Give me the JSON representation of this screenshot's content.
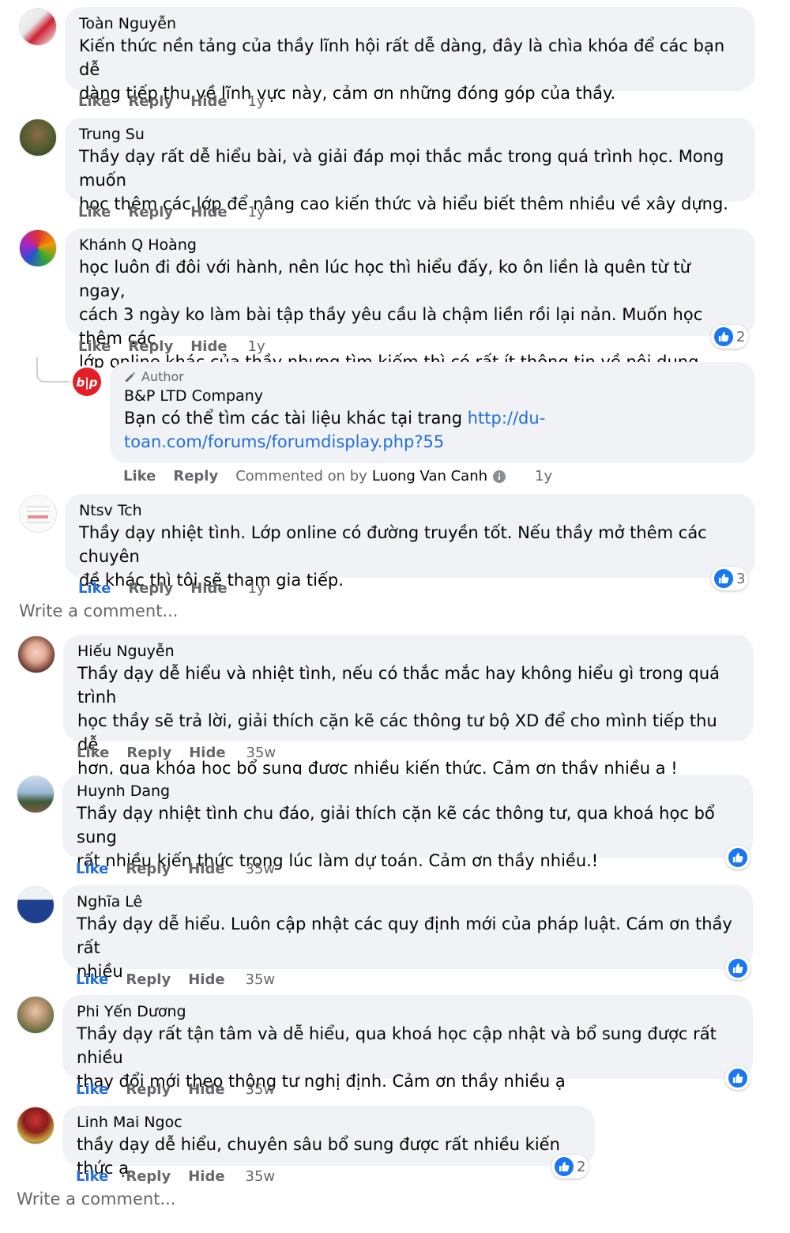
{
  "colors": {
    "bubble": "#f0f2f5",
    "meta": "#65676b",
    "link": "#216fdb",
    "like_blue": "#1877f2"
  },
  "actions": {
    "like": "Like",
    "reply": "Reply",
    "hide": "Hide"
  },
  "comments": [
    {
      "name": "Toàn Nguyễn",
      "lines": [
        "Kiến thức nền tảng của thầy lĩnh hội rất dễ dàng, đây là chìa khóa để các bạn dễ",
        "dàng tiếp thu về lĩnh vực này, cảm ơn những đóng góp của thầy."
      ],
      "time": "1y"
    },
    {
      "name": "Trung Su",
      "lines": [
        "Thầy dạy rất dễ hiểu bài, và giải đáp mọi thắc mắc trong quá trình học. Mong muốn",
        "học thêm các lớp để nâng cao kiến thức và hiểu biết thêm nhiều về xây dựng."
      ],
      "time": "1y"
    },
    {
      "name": "Khánh Q Hoàng",
      "lines": [
        "học luôn đi đôi với hành, nên lúc học thì hiểu đấy, ko ôn liền là quên từ từ ngay,",
        "cách 3 ngày ko làm bài tập thầy yêu cầu là chậm liền rồi lại nản. Muốn học thêm các",
        "lớp online khác của thầy nhưng tìm kiếm thì có rất ít thông tin về nội dung."
      ],
      "time": "1y",
      "reactions": "2"
    },
    {
      "name": "Ntsv Tch",
      "lines": [
        "Thầy dạy nhiệt tình. Lớp online có đường truyền tốt. Nếu thầy mở thêm các chuyên",
        "đề khác thì tôi sẽ tham gia tiếp."
      ],
      "time": "1y",
      "reactions": "3"
    },
    {
      "name": "Hiếu Nguyễn",
      "lines": [
        "Thầy dạy dễ hiểu và nhiệt tình, nếu có thắc mắc hay không hiểu gì trong quá trình",
        "học thầy sẽ trả lời, giải thích cặn kẽ các thông tư bộ XD để cho mình tiếp thu dễ",
        "hơn, qua khóa học bổ sung được nhiều kiến thức. Cảm ơn thầy nhiều ạ !"
      ],
      "time": "35w"
    },
    {
      "name": "Huynh Dang",
      "lines": [
        "Thầy dạy nhiệt tình chu đáo, giải thích cặn kẽ các thông tư, qua khoá học bổ sung",
        "rất nhiều kiến thức trong lúc làm dự toán. Cảm ơn thầy nhiều.!"
      ],
      "time": "35w"
    },
    {
      "name": "Nghĩa Lê",
      "lines": [
        "Thầy dạy dễ hiểu. Luôn cập nhật các quy định mới của pháp luật. Cám ơn thầy rất",
        "nhiều"
      ],
      "time": "35w"
    },
    {
      "name": "Phi Yến Dương",
      "lines": [
        "Thầy dạy rất tận tâm và dễ hiểu, qua khoá học cập nhật và bổ sung được rất nhiều",
        "thay đổi mới theo thông tư nghị định. Cảm ơn thầy nhiều ạ"
      ],
      "time": "35w"
    },
    {
      "name": "Linh Mai Ngoc",
      "lines": [
        "thầy dạy dễ hiểu, chuyên sâu bổ sung được rất nhiều kiến thức ạ"
      ],
      "time": "35w",
      "reactions": "2"
    }
  ],
  "reply": {
    "author_label": "Author",
    "name": "B&P LTD Company",
    "text": "Bạn có thể tìm các tài liệu khác tại trang ",
    "link_line1": "http://du-",
    "link_line2": "toan.com/forums/forumdisplay.php?55",
    "commented_on_by": "Commented on by",
    "commenter": "Luong Van Canh",
    "time": "1y",
    "logo_text": "b|p"
  },
  "write_comment": "Write a comment..."
}
